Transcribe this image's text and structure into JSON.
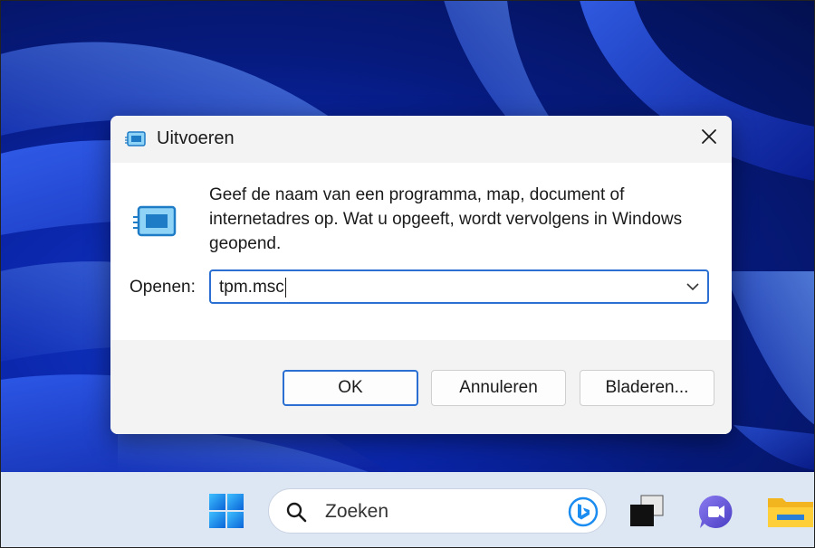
{
  "dialog": {
    "title": "Uitvoeren",
    "description": "Geef de naam van een programma, map, document of internetadres op. Wat u opgeeft, wordt vervolgens in Windows geopend.",
    "open_label": "Openen:",
    "input_value": "tpm.msc",
    "buttons": {
      "ok": "OK",
      "cancel": "Annuleren",
      "browse": "Bladeren..."
    }
  },
  "taskbar": {
    "search_placeholder": "Zoeken",
    "icons": [
      "windows-start-icon",
      "search-icon",
      "bing-icon",
      "task-view-icon",
      "chat-icon",
      "file-explorer-icon"
    ]
  },
  "colors": {
    "accent": "#2a6fd1",
    "taskbar": "#dde6f3",
    "dialog_bg": "#f3f3f3",
    "wallpaper": "#0a25a8"
  }
}
